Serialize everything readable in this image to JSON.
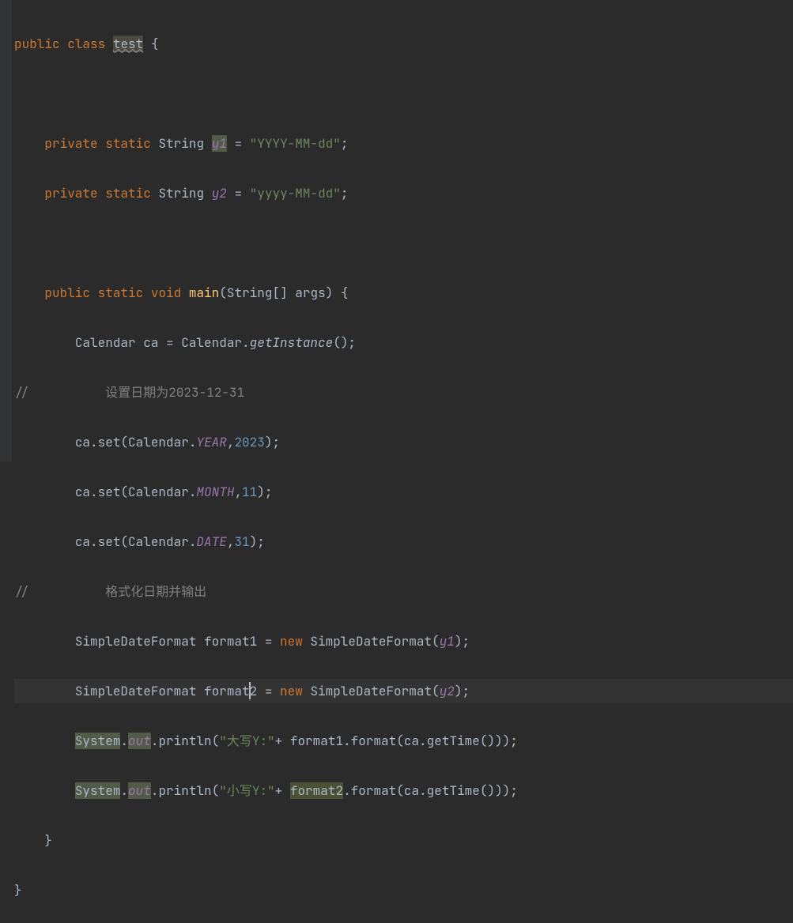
{
  "code": {
    "l1_public": "public",
    "l1_class": "class",
    "l1_name": "test",
    "l1_brace": " {",
    "l3_private": "private",
    "l3_static": "static",
    "l3_type": "String",
    "l3_var": "y1",
    "l3_eq": " = ",
    "l3_str": "\"YYYY-MM-dd\"",
    "l3_semi": ";",
    "l4_private": "private",
    "l4_static": "static",
    "l4_type": "String",
    "l4_var": "y2",
    "l4_eq": " = ",
    "l4_str": "\"yyyy-MM-dd\"",
    "l4_semi": ";",
    "l6_public": "public",
    "l6_static": "static",
    "l6_void": "void",
    "l6_main": "main",
    "l6_args": "(String[] args) {",
    "l7_cal": "Calendar ca = Calendar.",
    "l7_getinst": "getInstance",
    "l7_tail": "();",
    "l8_slash": "//",
    "l8_text": "设置日期为2023-12-31",
    "l9_caset": "ca.set(Calendar.",
    "l9_year": "YEAR",
    "l9_comma": ",",
    "l9_val": "2023",
    "l9_tail": ");",
    "l10_caset": "ca.set(Calendar.",
    "l10_month": "MONTH",
    "l10_comma": ",",
    "l10_val": "11",
    "l10_tail": ");",
    "l11_caset": "ca.set(Calendar.",
    "l11_date": "DATE",
    "l11_comma": ",",
    "l11_val": "31",
    "l11_tail": ");",
    "l12_slash": "//",
    "l12_text": "格式化日期并输出",
    "l13_a": "SimpleDateFormat format1 = ",
    "l13_new": "new",
    "l13_b": " SimpleDateFormat(",
    "l13_y1": "y1",
    "l13_tail": ");",
    "l14_a": "SimpleDateFormat forma",
    "l14_t": "t",
    "l14_a2": "2 = ",
    "l14_new": "new",
    "l14_b": " SimpleDateFormat(",
    "l14_y2": "y2",
    "l14_tail": ");",
    "l15_sys": "System",
    "l15_dot": ".",
    "l15_out": "out",
    "l15_prn": ".println(",
    "l15_str": "\"大写Y:\"",
    "l15_plus": "+ format1.format(ca.getTime()));",
    "l16_sys": "System",
    "l16_dot": ".",
    "l16_out": "out",
    "l16_prn": ".println(",
    "l16_str": "\"小写Y:\"",
    "l16_plus": "+ ",
    "l16_fmt2": "format2",
    "l16_rest": ".format(ca.getTime()));",
    "l17_brace": "}",
    "l18_brace": "}"
  }
}
